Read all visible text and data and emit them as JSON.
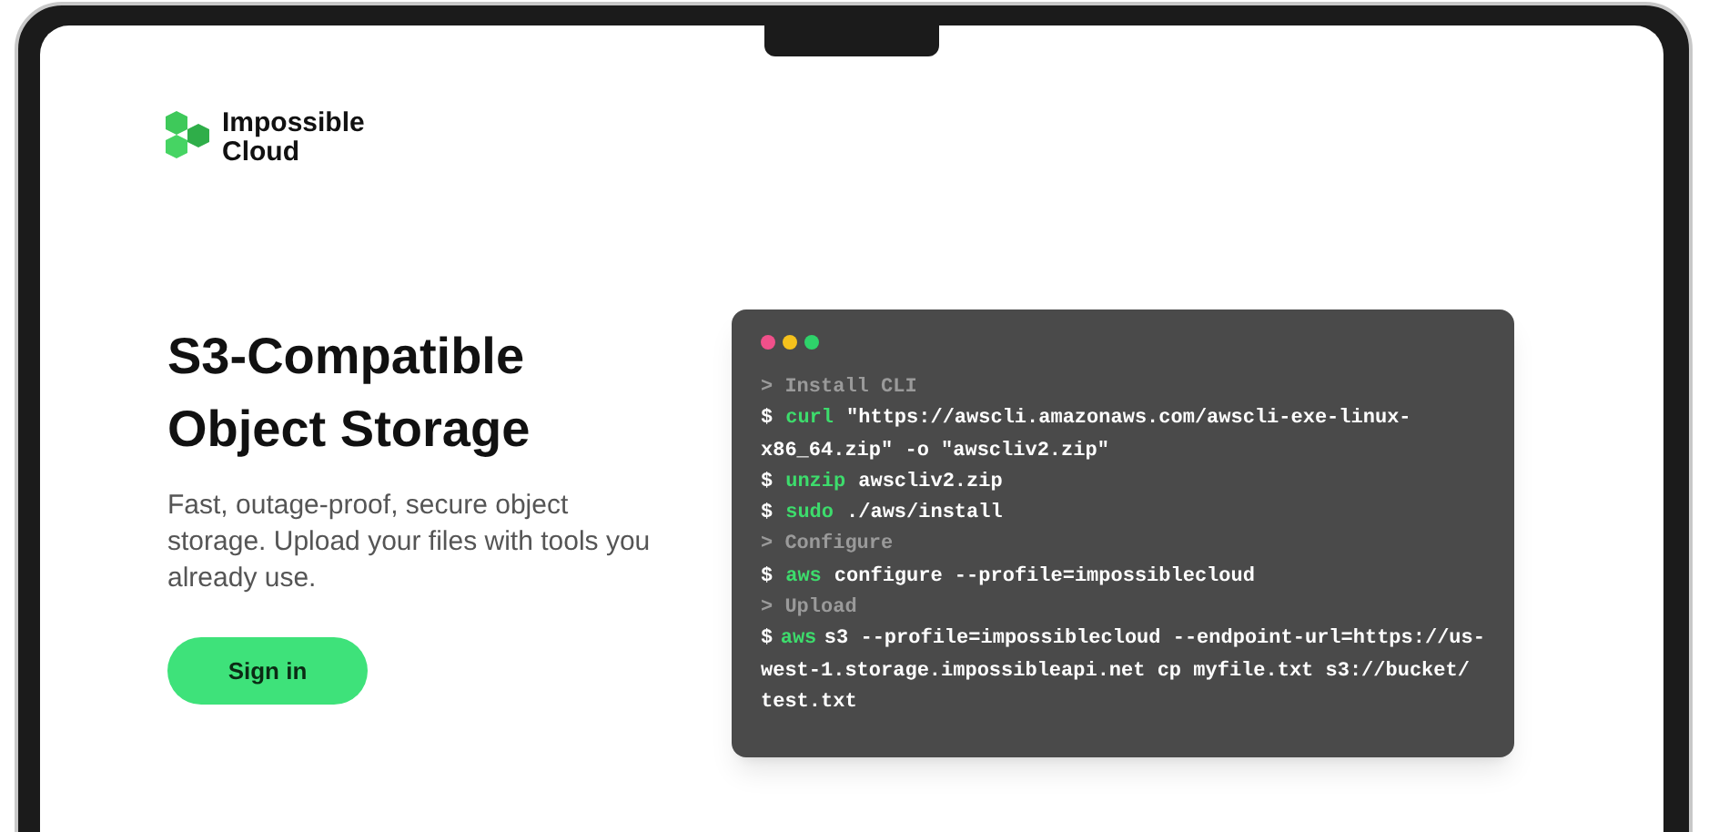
{
  "brand": {
    "name_lines": [
      "Impossible",
      "Cloud"
    ]
  },
  "hero": {
    "title_lines": [
      "S3-Compatible",
      "Object Storage"
    ],
    "description": "Fast, outage-proof, secure object storage. Upload your files with tools you already use.",
    "button": "Sign in"
  },
  "terminal": {
    "lines": [
      {
        "kind": "comment",
        "prompt": ">",
        "text": "Install CLI"
      },
      {
        "kind": "command",
        "prompt": "$",
        "program": "curl",
        "text": "\"https://awscli.amazonaws.com/awscli-exe-linux-"
      },
      {
        "kind": "continuation",
        "text": "x86_64.zip\" -o \"awscliv2.zip\""
      },
      {
        "kind": "command",
        "prompt": "$",
        "program": "unzip",
        "text": "awscliv2.zip"
      },
      {
        "kind": "command",
        "prompt": "$",
        "program": "sudo",
        "text": "./aws/install"
      },
      {
        "kind": "comment",
        "prompt": ">",
        "text": "Configure"
      },
      {
        "kind": "command",
        "prompt": "$",
        "program": "aws",
        "text": "configure --profile=impossiblecloud"
      },
      {
        "kind": "comment",
        "prompt": ">",
        "text": "Upload"
      },
      {
        "kind": "command",
        "prompt": "$",
        "program": "aws",
        "text": "s3 --profile=impossiblecloud --endpoint-url=https://us-"
      },
      {
        "kind": "continuation",
        "text": "west-1.storage.impossibleapi.net cp myfile.txt s3://bucket/"
      },
      {
        "kind": "continuation",
        "text": "test.txt"
      }
    ]
  }
}
